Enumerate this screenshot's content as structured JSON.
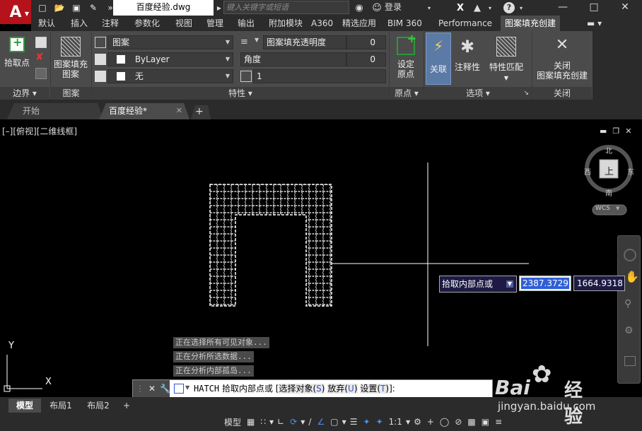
{
  "titlebar": {
    "document_name": "百度经验.dwg",
    "search_placeholder": "键入关键字或短语",
    "login_label": "登录",
    "help_label": "?"
  },
  "ribbon_tabs": [
    "默认",
    "插入",
    "注释",
    "参数化",
    "视图",
    "管理",
    "输出",
    "附加模块",
    "A360",
    "精选应用",
    "BIM 360",
    "Performance",
    "图案填充创建"
  ],
  "ribbon": {
    "boundary": {
      "pick_points": "拾取点",
      "title": "边界"
    },
    "pattern": {
      "button": "图案填充\n图案",
      "button_line1": "图案填充",
      "button_line2": "图案",
      "title": "图案"
    },
    "properties": {
      "type_value": "图案",
      "color_value": "ByLayer",
      "bg_value": "无",
      "transparency_label": "图案填充透明度",
      "transparency_value": "0",
      "angle_label": "角度",
      "angle_value": "0",
      "scale_value": "1",
      "title": "特性"
    },
    "origin": {
      "button_line1": "设定",
      "button_line2": "原点",
      "title": "原点"
    },
    "options": {
      "associative": "关联",
      "annotative": "注释性",
      "match_line1": "特性匹配",
      "title": "选项"
    },
    "close": {
      "button_line1": "关闭",
      "button_line2": "图案填充创建",
      "title": "关闭"
    }
  },
  "file_tabs": [
    {
      "label": "开始"
    },
    {
      "label": "百度经验*"
    }
  ],
  "viewport": {
    "label": "[–][俯视][二维线框]",
    "compass": {
      "north": "北",
      "south": "南",
      "east": "东",
      "west": "西",
      "top": "上",
      "wcs": "WCS"
    }
  },
  "dynamic_input": {
    "prompt": "拾取内部点或",
    "x_value": "2387.3729",
    "y_value": "1664.9318"
  },
  "command_history": [
    "正在选择所有可见对象...",
    "正在分析所选数据...",
    "正在分析内部孤岛..."
  ],
  "command_line": {
    "command": "HATCH",
    "prompt": "拾取内部点或",
    "opt1": "选择对象",
    "opt1_key": "S",
    "opt2": "放弃",
    "opt2_key": "U",
    "opt3": "设置",
    "opt3_key": "T"
  },
  "layout_tabs": [
    "模型",
    "布局1",
    "布局2"
  ],
  "statusbar": {
    "model": "模型",
    "scale": "1:1"
  },
  "ucs": {
    "x": "X",
    "y": "Y"
  },
  "watermark": {
    "brand": "Bai",
    "brand2": "经验",
    "url": "jingyan.baidu.com"
  }
}
